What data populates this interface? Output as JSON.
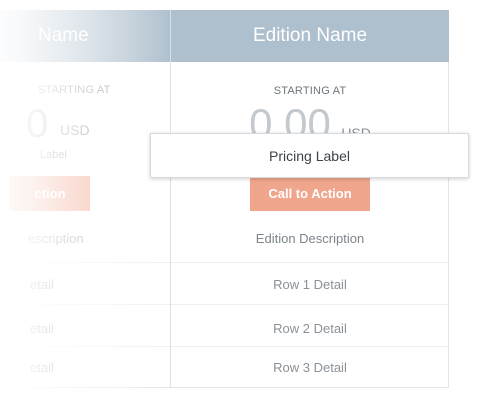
{
  "left_column": {
    "header": "Name",
    "starting_at": "STARTING AT",
    "price": "0",
    "currency": "USD",
    "pricing_label": "Label",
    "cta": "ction",
    "description": "escription",
    "rows": [
      "etail",
      "etail",
      "etail"
    ]
  },
  "right_column": {
    "header": "Edition Name",
    "starting_at": "STARTING AT",
    "price": "0.00",
    "currency": "USD",
    "cta": "Call to Action",
    "description": "Edition Description",
    "rows": [
      "Row 1 Detail",
      "Row 2 Detail",
      "Row 3 Detail"
    ]
  },
  "tooltip": {
    "text": "Pricing Label"
  },
  "colors": {
    "header_bg": "#aebfcd",
    "cta_bg": "#f0a58d",
    "border": "#e3e6e9"
  }
}
